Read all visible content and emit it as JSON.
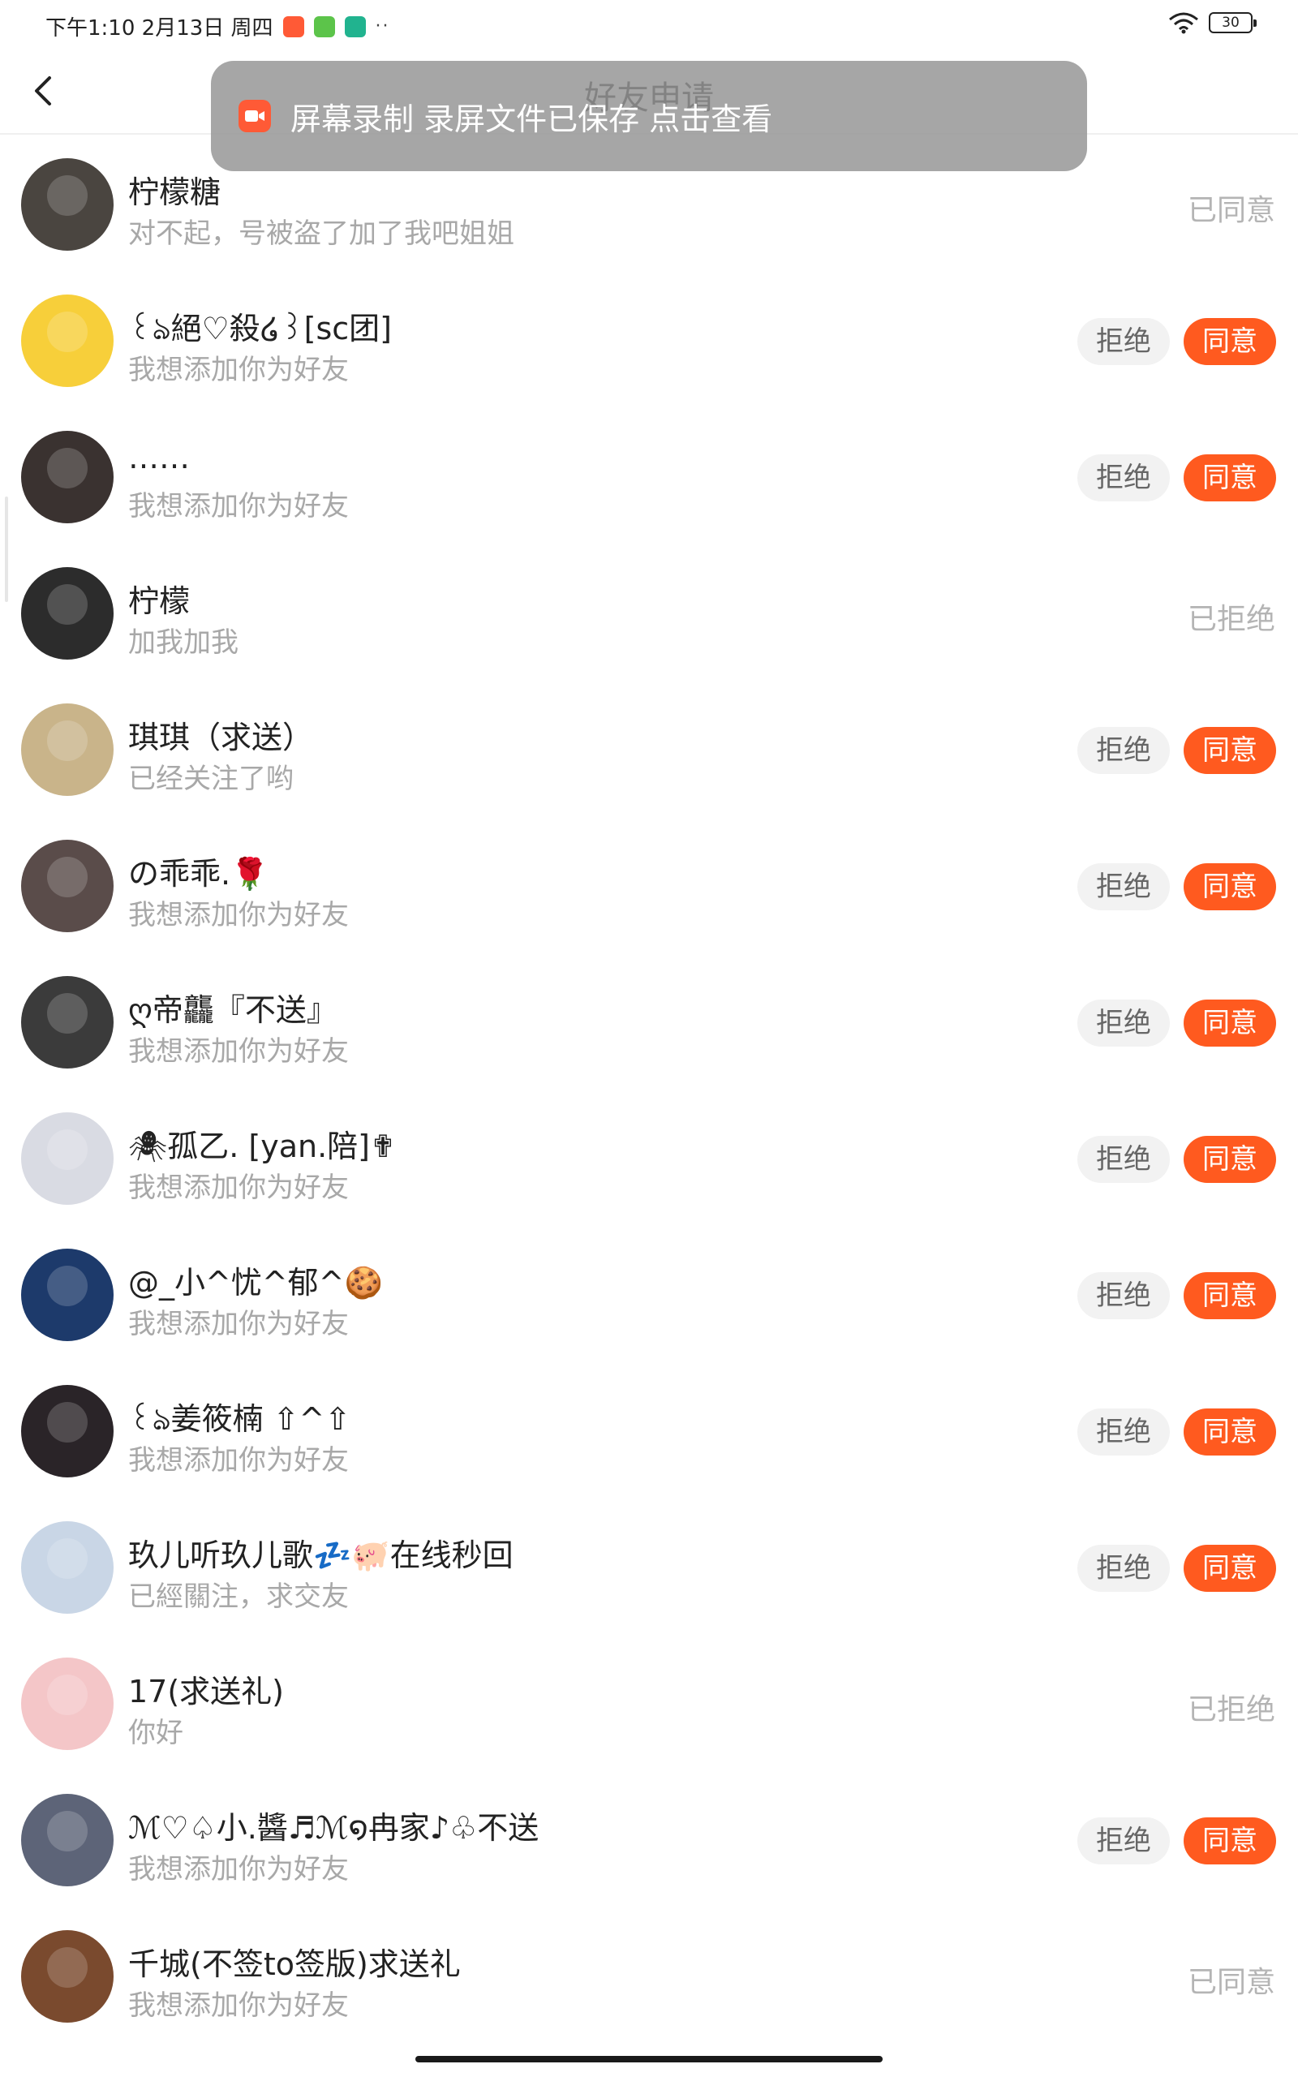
{
  "status_bar": {
    "time_date": "下午1:10  2月13日 周四",
    "dots": "··",
    "battery": "30",
    "app_icons": [
      "#ff5a36",
      "#5cc44a",
      "#21b38f"
    ]
  },
  "header": {
    "title": "好友申请"
  },
  "toast": {
    "text": "屏幕录制  录屏文件已保存 点击查看"
  },
  "actions": {
    "reject": "拒绝",
    "accept": "同意"
  },
  "requests": [
    {
      "name": "柠檬糖",
      "message": "对不起，号被盗了加了我吧姐姐",
      "status": "已同意",
      "avatar_color": "#4a4540"
    },
    {
      "name": "꒰ঌ絕♡殺໒꒱[sc团]",
      "message": "我想添加你为好友",
      "status": "pending",
      "avatar_color": "#f7cf3a"
    },
    {
      "name": "……",
      "message": "我想添加你为好友",
      "status": "pending",
      "avatar_color": "#3a3230"
    },
    {
      "name": "柠檬",
      "message": "加我加我",
      "status": "已拒绝",
      "avatar_color": "#2c2c2c"
    },
    {
      "name": "琪琪（求送）",
      "message": "已经关注了哟",
      "status": "pending",
      "avatar_color": "#c9b48a"
    },
    {
      "name": "の乖乖.🌹",
      "message": "我想添加你为好友",
      "status": "pending",
      "avatar_color": "#5a4c4a"
    },
    {
      "name": "ღ帝龘『不送』",
      "message": "我想添加你为好友",
      "status": "pending",
      "avatar_color": "#3b3b3b"
    },
    {
      "name": "🕷孤乙. [yan.陪]✟",
      "message": "我想添加你为好友",
      "status": "pending",
      "avatar_color": "#d9dbe3"
    },
    {
      "name": "@_小^忧^郁^🍪",
      "message": "我想添加你为好友",
      "status": "pending",
      "avatar_color": "#1d3a6b"
    },
    {
      "name": "꒰ঌ姜筱楠 ⇧^⇧",
      "message": "我想添加你为好友",
      "status": "pending",
      "avatar_color": "#2a2428"
    },
    {
      "name": "玖儿听玖儿歌💤🐖在线秒回",
      "message": "已經關注，求交友",
      "status": "pending",
      "avatar_color": "#c9d6e6"
    },
    {
      "name": "17(求送礼)",
      "message": "你好",
      "status": "已拒绝",
      "avatar_color": "#f4c6c8"
    },
    {
      "name": "ℳ♡♤小.醬♬ℳ໑冉家♪♧不送",
      "message": "我想添加你为好友",
      "status": "pending",
      "avatar_color": "#5d6478"
    },
    {
      "name": "千城(不签to签版)求送礼",
      "message": "我想添加你为好友",
      "status": "已同意",
      "avatar_color": "#7a4a2e"
    }
  ]
}
